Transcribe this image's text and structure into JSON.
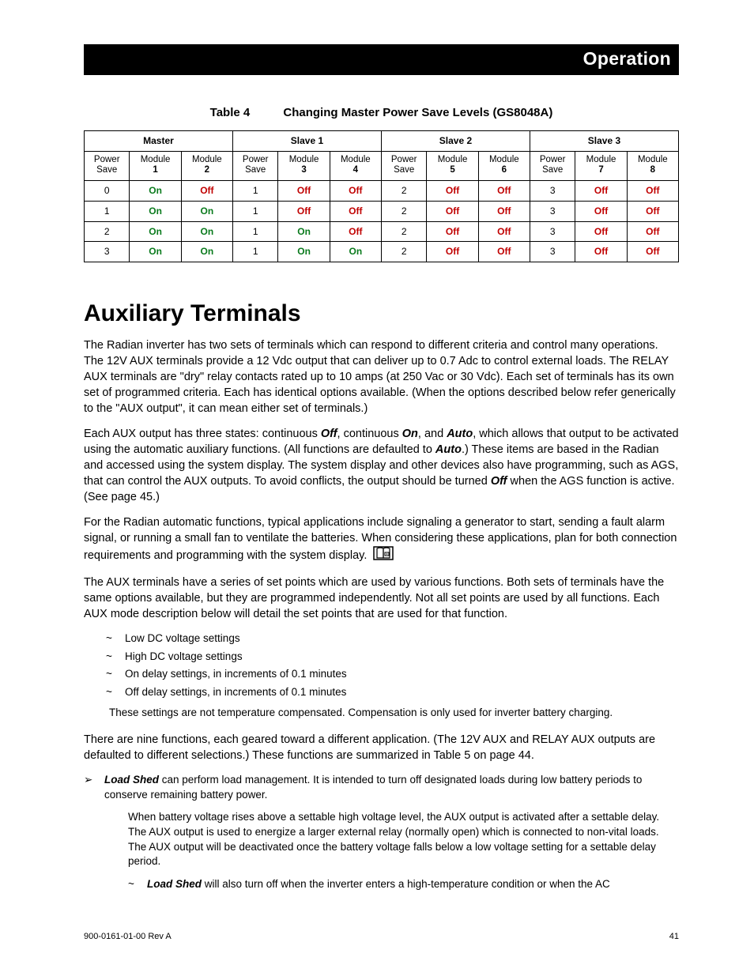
{
  "header": {
    "section": "Operation"
  },
  "table": {
    "label": "Table 4",
    "title": "Changing Master Power Save Levels (GS8048A)",
    "groups": [
      "Master",
      "Slave 1",
      "Slave 2",
      "Slave 3"
    ],
    "subheads": [
      "Power\nSave",
      "Module\n1",
      "Module\n2",
      "Power\nSave",
      "Module\n3",
      "Module\n4",
      "Power\nSave",
      "Module\n5",
      "Module\n6",
      "Power\nSave",
      "Module\n7",
      "Module\n8"
    ],
    "rows": [
      [
        "0",
        "On",
        "Off",
        "1",
        "Off",
        "Off",
        "2",
        "Off",
        "Off",
        "3",
        "Off",
        "Off"
      ],
      [
        "1",
        "On",
        "On",
        "1",
        "Off",
        "Off",
        "2",
        "Off",
        "Off",
        "3",
        "Off",
        "Off"
      ],
      [
        "2",
        "On",
        "On",
        "1",
        "On",
        "Off",
        "2",
        "Off",
        "Off",
        "3",
        "Off",
        "Off"
      ],
      [
        "3",
        "On",
        "On",
        "1",
        "On",
        "On",
        "2",
        "Off",
        "Off",
        "3",
        "Off",
        "Off"
      ]
    ]
  },
  "heading": "Auxiliary Terminals",
  "p1": "The Radian inverter has two sets of terminals which can respond to different criteria and control many operations.  The 12V AUX terminals provide a 12 Vdc output that can deliver up to 0.7 Adc to control external loads.  The RELAY AUX terminals are \"dry\" relay contacts rated up to 10 amps (at 250 Vac or 30 Vdc).  Each set of terminals has its own set of programmed criteria.  Each has identical options available.  (When the options described below refer generically to the \"AUX output\", it can mean either set of terminals.)",
  "p2": {
    "a": "Each AUX output has three states:  continuous ",
    "b": "Off",
    "c": ", continuous ",
    "d": "On",
    "e": ", and ",
    "f": "Auto",
    "g": ", which allows that output to be activated using the automatic auxiliary functions.  (All functions are defaulted to ",
    "h": "Auto",
    "i": ".)  These items are based in the Radian and accessed using the system display.  The system display and other devices also have programming, such as AGS, that can control the AUX outputs.  To avoid conflicts, the output should be turned ",
    "j": "Off",
    "k": " when the AGS function is active.  (See page 45.)"
  },
  "p3": "For the Radian automatic functions, typical applications include signaling a generator to start, sending a fault alarm signal, or running a small fan to ventilate the batteries.  When considering these applications, plan for both connection requirements and programming with the system display.",
  "p4": "The AUX terminals have a series of set points which are used by various functions.  Both sets of terminals have the same options available, but they are programmed independently.  Not all set points are used by all functions.  Each AUX mode description below will detail the set points that are used for that function.",
  "list": [
    "Low DC voltage settings",
    "High DC voltage settings",
    "On delay settings, in increments of 0.1 minutes",
    "Off delay settings, in increments of 0.1 minutes"
  ],
  "note": "These settings are not temperature compensated.  Compensation is only used for inverter battery charging.",
  "p5": "There are nine functions, each geared toward a different application.  (The 12V AUX and RELAY AUX outputs are defaulted to different selections.)  These functions are summarized in Table 5 on page 44.",
  "loadshed": {
    "name": "Load Shed",
    "intro": " can perform load management.  It is intended to turn off designated loads during low battery periods to conserve remaining battery power.",
    "detail": "When battery voltage rises above a settable high voltage level, the AUX output is activated after a settable delay.  The AUX output is used to energize a larger external relay (normally open) which is connected to non-vital loads.  The AUX output will be deactivated once the battery voltage falls below a low voltage setting for a settable delay period.",
    "sub_name": "Load Shed",
    "sub_text": " will also turn off when the inverter enters a high-temperature condition or when the AC"
  },
  "footer": {
    "rev": "900-0161-01-00 Rev A",
    "page": "41"
  }
}
